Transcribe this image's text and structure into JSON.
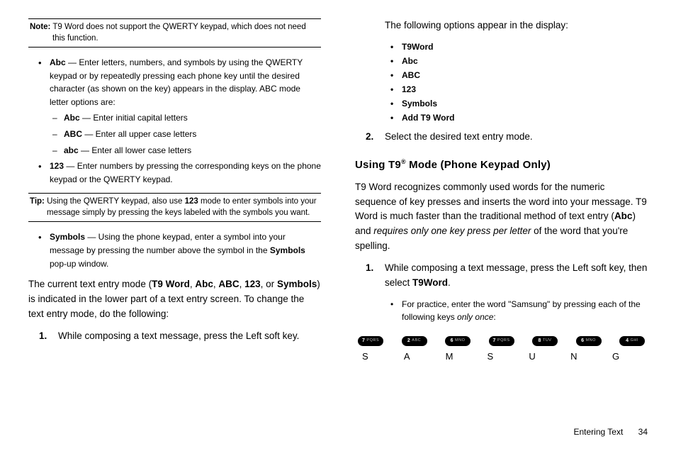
{
  "left": {
    "noteLabel": "Note:",
    "noteText": " T9 Word does not support the QWERTY keypad, which does not need this function.",
    "abc": {
      "term": "Abc",
      "desc": " — Enter letters, numbers, and symbols by using the QWERTY keypad or by repeatedly pressing each phone key until the desired character (as shown on the key) appears in the display. ABC mode letter options are:",
      "sub": [
        {
          "term": "Abc",
          "desc": " — Enter initial capital letters"
        },
        {
          "term": "ABC",
          "desc": " — Enter all upper case letters"
        },
        {
          "term": "abc",
          "desc": " — Enter all lower case letters"
        }
      ]
    },
    "n123": {
      "term": "123",
      "desc": " — Enter numbers by pressing the corresponding keys on the phone keypad or the QWERTY keypad."
    },
    "tipLabel": "Tip:",
    "tipPre": " Using the QWERTY keypad, also use ",
    "tipTerm": "123",
    "tipPost": " mode to enter symbols into your message simply by pressing the keys labeled with the symbols you want.",
    "symbols": {
      "term": "Symbols",
      "descPre": " — Using the phone keypad, enter a symbol into your message by pressing the number above the symbol in the ",
      "descTerm": "Symbols",
      "descPost": " pop-up window."
    },
    "modePara": {
      "p1": "The current text entry mode (",
      "t1": "T9 Word",
      "s1": ", ",
      "t2": "Abc",
      "s2": ", ",
      "t3": "ABC",
      "s3": ", ",
      "t4": "123",
      "s4": ", or ",
      "t5": "Symbols",
      "p2": ") is indicated in the lower part of a text entry screen. To change the text entry mode, do the following:"
    },
    "step1": "While composing a text message, press the Left soft key."
  },
  "right": {
    "intro": "The following options appear in the display:",
    "opts": [
      "T9Word",
      "Abc",
      "ABC",
      "123",
      "Symbols",
      "Add T9 Word"
    ],
    "step2": "Select the desired text entry mode.",
    "heading": {
      "pre": "Using T9",
      "sup": "®",
      "post": " Mode (Phone Keypad Only)"
    },
    "para": {
      "p1": "T9 Word recognizes commonly used words for the numeric sequence of key presses and inserts the word into your message. T9 Word is much faster than the traditional method of text entry (",
      "abc": "Abc",
      "p2": ") and ",
      "ital": "requires only one key press per letter",
      "p3": " of the word that you're spelling."
    },
    "rstep1": {
      "p1": "While composing a text message, press the Left soft key, then select ",
      "term": "T9Word",
      "p2": "."
    },
    "practice": {
      "p1": "For practice, enter the word \"Samsung\" by pressing each of the following keys ",
      "ital": "only once",
      "p2": ":"
    },
    "keys": [
      {
        "d": "7",
        "t": "PQRS"
      },
      {
        "d": "2",
        "t": "ABC"
      },
      {
        "d": "6",
        "t": "MNO"
      },
      {
        "d": "7",
        "t": "PQRS"
      },
      {
        "d": "8",
        "t": "TUV"
      },
      {
        "d": "6",
        "t": "MNO"
      },
      {
        "d": "4",
        "t": "GHI"
      }
    ],
    "letters": [
      "S",
      "A",
      "M",
      "S",
      "U",
      "N",
      "G"
    ]
  },
  "footer": {
    "section": "Entering Text",
    "page": "34"
  }
}
